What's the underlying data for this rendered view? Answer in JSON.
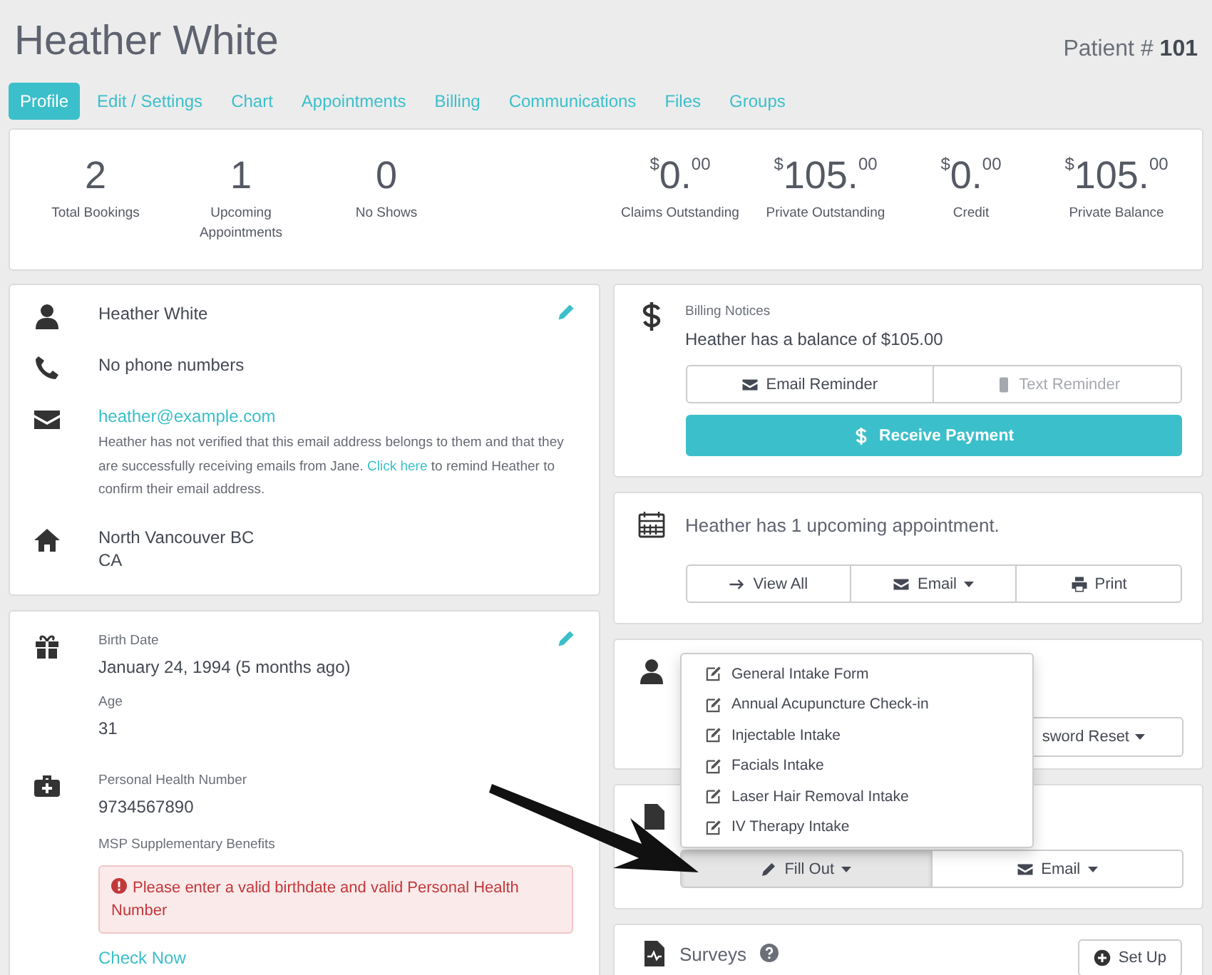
{
  "header": {
    "name": "Heather White",
    "patient_label": "Patient #",
    "patient_number": "101"
  },
  "tabs": [
    {
      "label": "Profile",
      "selected": true
    },
    {
      "label": "Edit / Settings",
      "selected": false
    },
    {
      "label": "Chart",
      "selected": false
    },
    {
      "label": "Appointments",
      "selected": false
    },
    {
      "label": "Billing",
      "selected": false
    },
    {
      "label": "Communications",
      "selected": false
    },
    {
      "label": "Files",
      "selected": false
    },
    {
      "label": "Groups",
      "selected": false
    }
  ],
  "stats": [
    {
      "kind": "count",
      "value": "2",
      "label": "Total Bookings"
    },
    {
      "kind": "count",
      "value": "1",
      "label": "Upcoming Appointments"
    },
    {
      "kind": "count",
      "value": "0",
      "label": "No Shows"
    },
    {
      "kind": "money",
      "currency": "$",
      "whole": "0.",
      "cents": "00",
      "label": "Claims Outstanding"
    },
    {
      "kind": "money",
      "currency": "$",
      "whole": "105.",
      "cents": "00",
      "label": "Private Outstanding"
    },
    {
      "kind": "money",
      "currency": "$",
      "whole": "0.",
      "cents": "00",
      "label": "Credit"
    },
    {
      "kind": "money",
      "currency": "$",
      "whole": "105.",
      "cents": "00",
      "label": "Private Balance"
    }
  ],
  "contact": {
    "name": "Heather White",
    "phone": "No phone numbers",
    "email": "heather@example.com",
    "notice_before": "Heather has not verified that this email address belongs to them and that they are successfully receiving emails from Jane.",
    "notice_link": "Click here",
    "notice_after": "to remind Heather to confirm their email address.",
    "address": [
      "North Vancouver BC",
      "CA"
    ]
  },
  "details": {
    "birth_date_label": "Birth Date",
    "birth_date": "January 24, 1994 (5 months ago)",
    "age_label": "Age",
    "age": "31",
    "phn_label": "Personal Health Number",
    "phn": "9734567890",
    "msp_label": "MSP Supplementary Benefits",
    "msp_alert": "Please enter a valid birthdate and valid Personal Health Number",
    "check_link": "Check Now"
  },
  "billing": {
    "label": "Billing Notices",
    "balance": "Heather has a balance of $105.00",
    "buttons": [
      {
        "label": "Email Reminder",
        "kind": "email",
        "disabled": false
      },
      {
        "label": "Text Reminder",
        "kind": "text",
        "disabled": true
      }
    ],
    "payment_button": "Receive Payment"
  },
  "appointments": {
    "text": "Heather has 1 upcoming appointment.",
    "buttons": [
      {
        "label": "View All",
        "kind": "view",
        "caret": false
      },
      {
        "label": "Email",
        "kind": "email",
        "caret": true
      },
      {
        "label": "Print",
        "kind": "print",
        "caret": false
      }
    ]
  },
  "portal": {
    "button": "sword Reset"
  },
  "forms": {
    "buttons": [
      {
        "label": "Fill Out",
        "kind": "fill",
        "pressed": true
      },
      {
        "label": "Email",
        "kind": "email",
        "pressed": false
      }
    ],
    "menu": [
      "General Intake Form",
      "Annual Acupuncture Check-in",
      "Injectable Intake",
      "Facials Intake",
      "Laser Hair Removal Intake",
      "IV Therapy Intake"
    ]
  },
  "surveys": {
    "title": "Surveys",
    "button": "Set Up"
  }
}
